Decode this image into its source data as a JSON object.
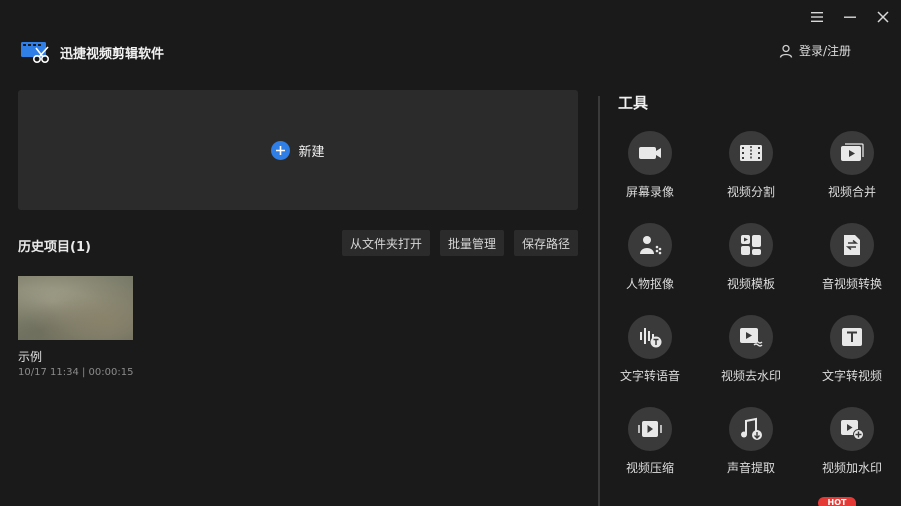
{
  "app": {
    "title": "迅捷视频剪辑软件"
  },
  "window_controls": {
    "menu_icon": "menu-icon",
    "minimize_icon": "minimize-icon",
    "close_icon": "close-icon"
  },
  "header": {
    "login_label": "登录/注册"
  },
  "new_project": {
    "label": "新建"
  },
  "history": {
    "title": "历史项目(1)",
    "buttons": {
      "open_folder": "从文件夹打开",
      "batch_manage": "批量管理",
      "save_path": "保存路径"
    },
    "items": [
      {
        "name": "示例",
        "meta": "10/17 11:34 | 00:00:15"
      }
    ]
  },
  "tools": {
    "title": "工具",
    "items": [
      {
        "label": "屏幕录像",
        "icon": "camera-icon"
      },
      {
        "label": "视频分割",
        "icon": "film-split-icon"
      },
      {
        "label": "视频合并",
        "icon": "video-merge-icon"
      },
      {
        "label": "人物抠像",
        "icon": "person-cutout-icon"
      },
      {
        "label": "视频模板",
        "icon": "template-icon"
      },
      {
        "label": "音视频转换",
        "icon": "convert-icon"
      },
      {
        "label": "文字转语音",
        "icon": "text-to-speech-icon"
      },
      {
        "label": "视频去水印",
        "icon": "remove-watermark-icon"
      },
      {
        "label": "文字转视频",
        "icon": "text-to-video-icon"
      },
      {
        "label": "视频压缩",
        "icon": "compress-icon"
      },
      {
        "label": "声音提取",
        "icon": "audio-extract-icon"
      },
      {
        "label": "视频加水印",
        "icon": "add-watermark-icon"
      }
    ],
    "hot_badge": "HOT"
  },
  "colors": {
    "background": "#1a1a1b",
    "panel": "#2b2b2c",
    "accent": "#2f7fe6",
    "tool_circle": "#3a3a3b",
    "hot": "#e53935"
  }
}
